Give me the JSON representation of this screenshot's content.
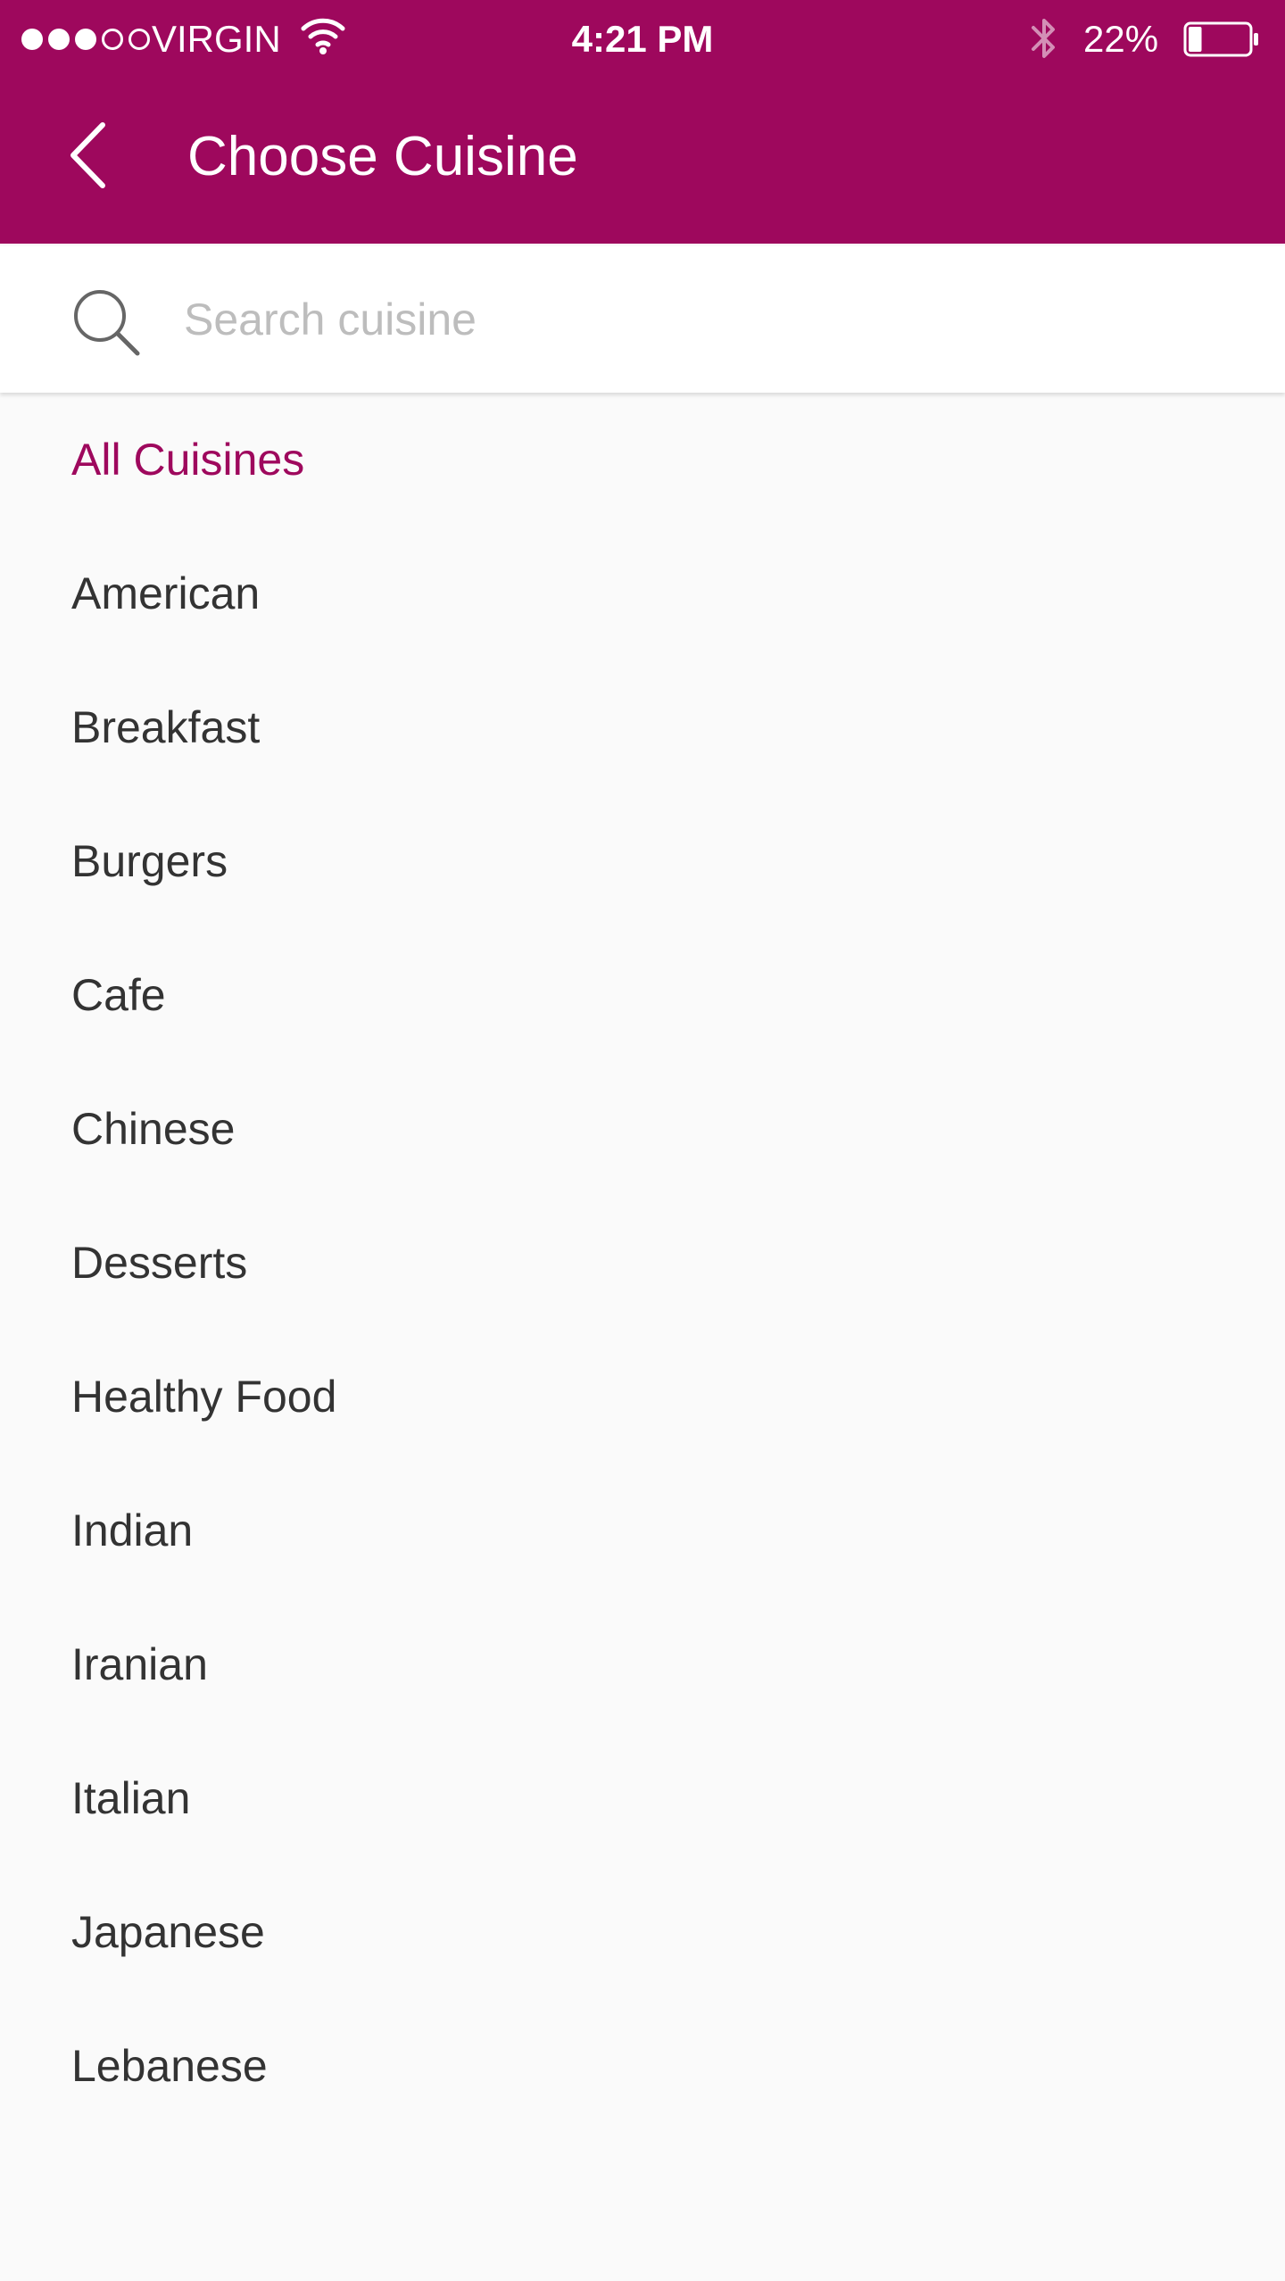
{
  "status_bar": {
    "carrier": "VIRGIN",
    "signal_bars_filled": 3,
    "signal_bars_total": 5,
    "time": "4:21 PM",
    "battery_percent": "22%",
    "battery_level": 0.22,
    "icons": [
      "signal-dots-icon",
      "wifi-icon",
      "bluetooth-icon",
      "battery-icon"
    ]
  },
  "header": {
    "title": "Choose Cuisine",
    "back_icon": "chevron-left-icon",
    "background_color": "#9E085D"
  },
  "search": {
    "placeholder": "Search cuisine",
    "value": "",
    "icon": "search-icon"
  },
  "cuisines": {
    "selected_index": 0,
    "accent_color": "#9E085D",
    "items": [
      {
        "label": "All Cuisines"
      },
      {
        "label": "American"
      },
      {
        "label": "Breakfast"
      },
      {
        "label": "Burgers"
      },
      {
        "label": "Cafe"
      },
      {
        "label": "Chinese"
      },
      {
        "label": "Desserts"
      },
      {
        "label": "Healthy Food"
      },
      {
        "label": "Indian"
      },
      {
        "label": "Iranian"
      },
      {
        "label": "Italian"
      },
      {
        "label": "Japanese"
      },
      {
        "label": "Lebanese"
      }
    ]
  }
}
